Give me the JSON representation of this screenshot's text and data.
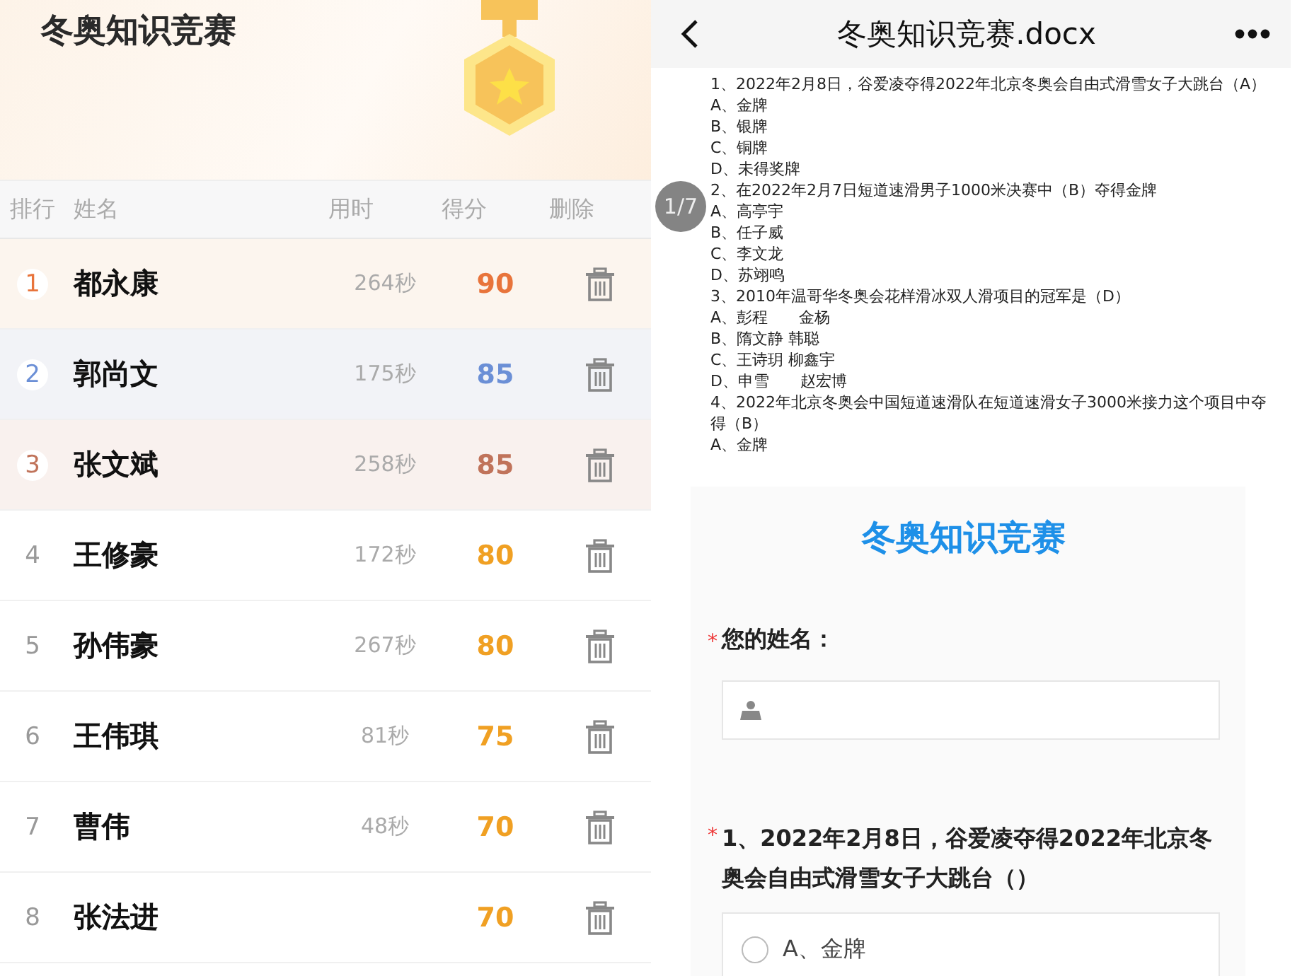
{
  "leaderboard": {
    "title": "冬奥知识竞赛",
    "columns": {
      "rank": "排行",
      "name": "姓名",
      "time": "用时",
      "score": "得分",
      "delete": "删除"
    },
    "rows": [
      {
        "rank": "1",
        "name": "都永康",
        "time": "264秒",
        "score": "90",
        "kind": "gold",
        "color": "#e8743b"
      },
      {
        "rank": "2",
        "name": "郭尚文",
        "time": "175秒",
        "score": "85",
        "kind": "silver",
        "color": "#6b8fd6"
      },
      {
        "rank": "3",
        "name": "张文斌",
        "time": "258秒",
        "score": "85",
        "kind": "bronze",
        "color": "#c0735a"
      },
      {
        "rank": "4",
        "name": "王修豪",
        "time": "172秒",
        "score": "80",
        "kind": "plain",
        "color": "#f0a023"
      },
      {
        "rank": "5",
        "name": "孙伟豪",
        "time": "267秒",
        "score": "80",
        "kind": "plain",
        "color": "#f0a023"
      },
      {
        "rank": "6",
        "name": "王伟琪",
        "time": "81秒",
        "score": "75",
        "kind": "plain",
        "color": "#f0a023"
      },
      {
        "rank": "7",
        "name": "曹伟",
        "time": "48秒",
        "score": "70",
        "kind": "plain",
        "color": "#f0a023"
      },
      {
        "rank": "8",
        "name": "张法进",
        "score": "70",
        "kind": "plain",
        "color": "#f0a023"
      }
    ]
  },
  "viewer": {
    "title": "冬奥知识竞赛.docx",
    "page_indicator": "1/7",
    "lines": [
      "1、2022年2月8日，谷爱凌夺得2022年北京冬奥会自由式滑雪女子大跳台（A）",
      "A、金牌",
      "B、银牌",
      "C、铜牌",
      "D、未得奖牌",
      "2、在2022年2月7日短道速滑男子1000米决赛中（B）夺得金牌",
      "A、高亭宇",
      "B、任子威",
      "C、李文龙",
      "D、苏翊鸣",
      "3、2010年温哥华冬奥会花样滑冰双人滑项目的冠军是（D）",
      "A、彭程　　金杨",
      "B、隋文静  韩聪",
      "C、王诗玥  柳鑫宇",
      "D、申雪　　赵宏博",
      "4、2022年北京冬奥会中国短道速滑队在短道速滑女子3000米接力这个项目中夺得（B）",
      "A、金牌"
    ]
  },
  "form": {
    "title": "冬奥知识竞赛",
    "fields": [
      {
        "kind": "text",
        "mark": "*",
        "label": "您的姓名："
      },
      {
        "kind": "choice",
        "mark": "*",
        "label": "1、2022年2月8日，谷爱凌夺得2022年北京冬奥会自由式滑雪女子大跳台（）",
        "options": [
          {
            "label": "A、金牌",
            "selected": false
          }
        ]
      }
    ]
  }
}
